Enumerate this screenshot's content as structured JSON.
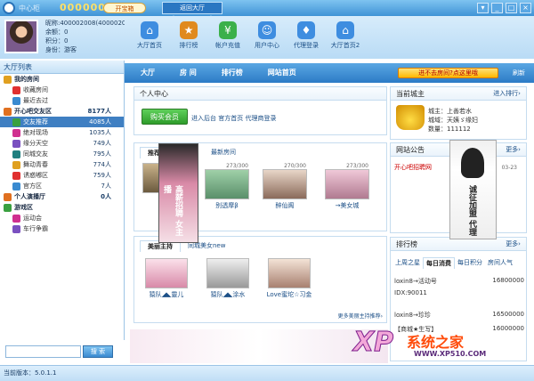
{
  "titlebar": {
    "app_name": "中心柜",
    "id_number": "000000000",
    "kaibao": "开宝箱",
    "hall_button": "返回大厅(400002008)"
  },
  "user": {
    "name": "昵称:400002008(4000020",
    "balance": "余额：0",
    "points": "积分：0",
    "status": "身份：游客"
  },
  "topnav": [
    {
      "label": "大厅首页",
      "icon": "home-icon",
      "color": "#3e8de0"
    },
    {
      "label": "排行榜",
      "icon": "ranking-icon",
      "color": "#e08a1e"
    },
    {
      "label": "帐户充值",
      "icon": "money-icon",
      "color": "#3ab04a"
    },
    {
      "label": "用户中心",
      "icon": "user-icon",
      "color": "#3e8de0"
    },
    {
      "label": "代理登录",
      "icon": "agent-icon",
      "color": "#3e8de0"
    },
    {
      "label": "大厅首页2",
      "icon": "home2-icon",
      "color": "#3e8de0"
    }
  ],
  "sidebar": {
    "title": "大厅列表",
    "items": [
      {
        "label": "我的房间",
        "count": "",
        "group": true
      },
      {
        "label": "收藏房间",
        "count": "",
        "group": false
      },
      {
        "label": "最近去过",
        "count": "",
        "group": false
      },
      {
        "label": "开心吧交友区",
        "count": "8177人",
        "group": true
      },
      {
        "label": "交友推荐",
        "count": "4085人",
        "group": false,
        "selected": true
      },
      {
        "label": "绝对现场",
        "count": "1035人",
        "group": false
      },
      {
        "label": "缘分天空",
        "count": "749人",
        "group": false
      },
      {
        "label": "同城交友",
        "count": "795人",
        "group": false
      },
      {
        "label": "舞动青春",
        "count": "774人",
        "group": false
      },
      {
        "label": "诱惑嘟区",
        "count": "759人",
        "group": false
      },
      {
        "label": "官方区",
        "count": "7人",
        "group": false
      },
      {
        "label": "个人演播厅",
        "count": "0人",
        "group": true
      },
      {
        "label": "游戏区",
        "count": "",
        "group": true
      },
      {
        "label": "运动会",
        "count": "",
        "group": false
      },
      {
        "label": "车行争霸",
        "count": "",
        "group": false
      }
    ]
  },
  "search": {
    "button": "搜 索"
  },
  "status": {
    "version": "当前版本：5.0.1.1"
  },
  "tabs": [
    "大厅",
    "房 间",
    "排行榜",
    "网站首页"
  ],
  "banner": "进不去房间?点这里哦",
  "refresh": "刷新",
  "center": {
    "title": "个人中心",
    "buy": "购买会员",
    "links": "进入后台  官方首页  代理商登录"
  },
  "host": {
    "title": "当前城主",
    "more": "进入排行›",
    "lines": [
      "城主：上善若水",
      "城域：天姨ゞ缘妇",
      "数量：111112"
    ]
  },
  "recommend": {
    "tabs": [
      "推荐",
      "最新房间"
    ],
    "rooms": [
      {
        "name": "--美",
        "count": ""
      },
      {
        "name": "别透摩β",
        "count": "273/300"
      },
      {
        "name": "醉仙阁",
        "count": "270/300"
      },
      {
        "name": "→美女城",
        "count": "273/300"
      }
    ]
  },
  "anchors": {
    "tabs": [
      "美丽主持",
      "同城美女new"
    ],
    "items": [
      {
        "name": "猿队◢◣靈儿"
      },
      {
        "name": "猿队◢◣涂水"
      },
      {
        "name": "Love蜜坨☆习金"
      }
    ],
    "more": "更多美丽主持推荐›"
  },
  "notice": {
    "title": "网站公告",
    "more": "更多›",
    "items": [
      "开心吧招聘网",
      "03-23"
    ]
  },
  "ranking": {
    "title": "排行榜",
    "more": "更多›",
    "tabs": [
      "上周之星",
      "每日消费",
      "每日积分",
      "房间人气"
    ],
    "rows": [
      {
        "name": "loxin8→活动号",
        "value": "16800000"
      },
      {
        "name": "IDX:90011",
        "value": ""
      },
      {
        "name": "loxin8→珍珍",
        "value": "16500000"
      },
      {
        "name": "【商城★生写】",
        "value": "16000000"
      }
    ]
  },
  "ad": {
    "text": "高薪招聘 女主播",
    "text2": "诚征加盟 代理"
  },
  "watermark": {
    "xp": "XP",
    "cn": "系统之家",
    "url": "WWW.XP510.COM"
  }
}
